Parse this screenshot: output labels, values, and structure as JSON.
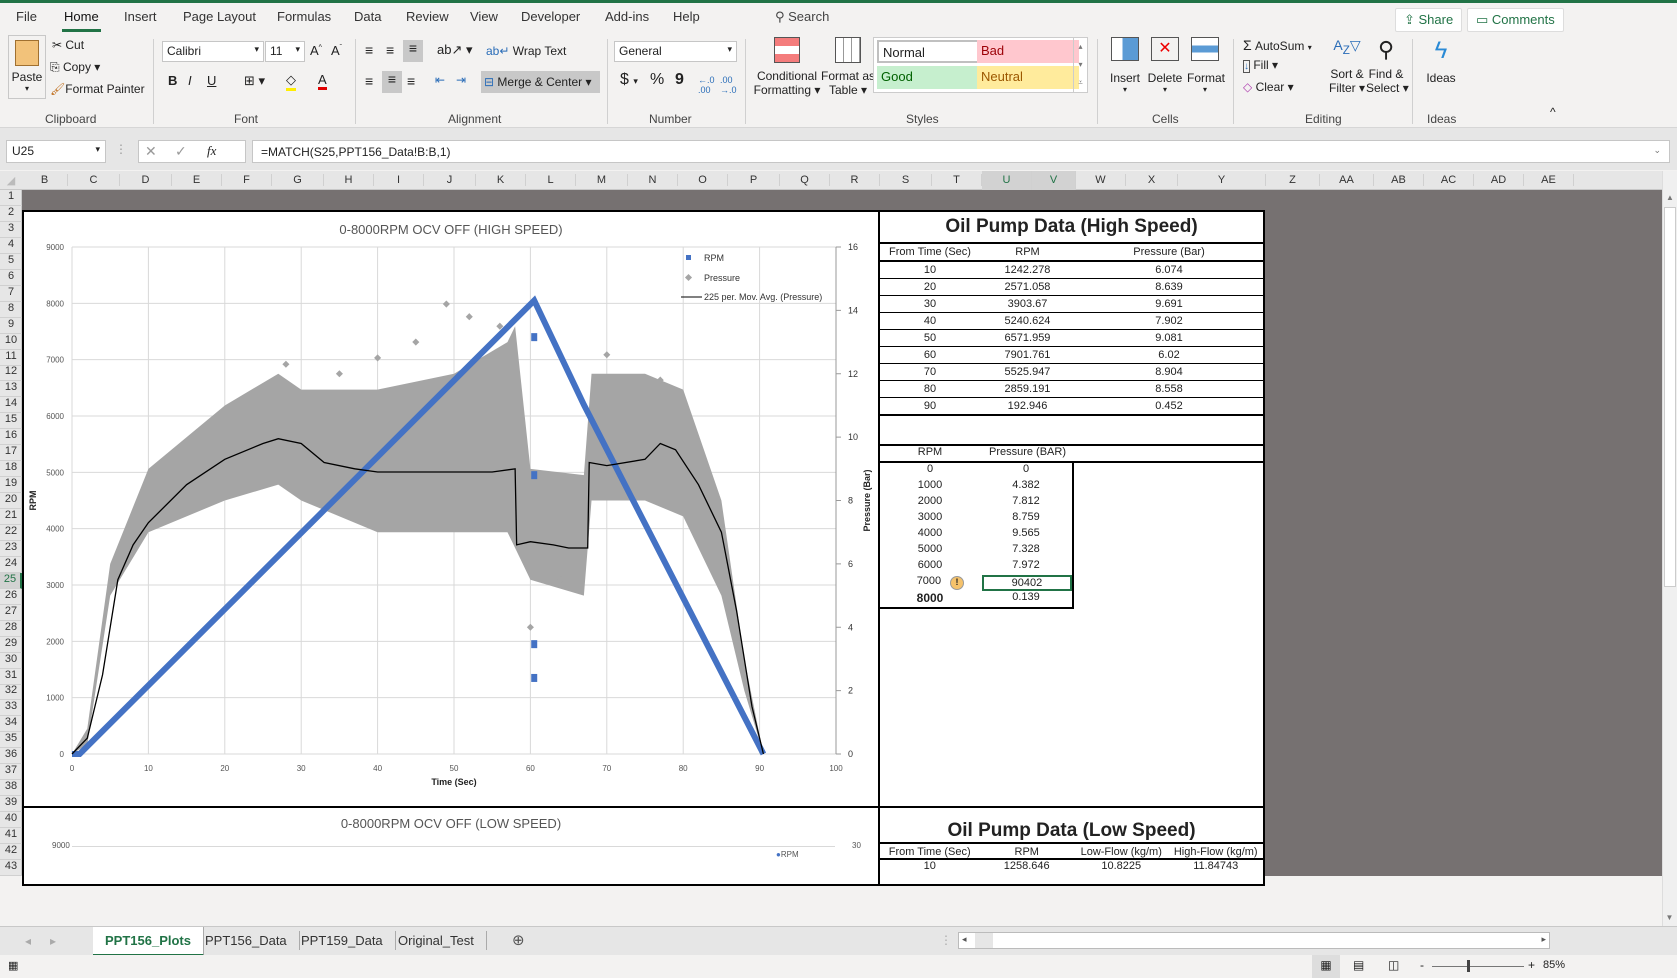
{
  "menu": {
    "items": [
      "File",
      "Home",
      "Insert",
      "Page Layout",
      "Formulas",
      "Data",
      "Review",
      "View",
      "Developer",
      "Add-ins",
      "Help"
    ],
    "active": "Home",
    "search": "Search",
    "share": "Share",
    "comments": "Comments"
  },
  "ribbon": {
    "clipboard": {
      "paste": "Paste",
      "cut": "Cut",
      "copy": "Copy",
      "format_painter": "Format Painter",
      "label": "Clipboard"
    },
    "font": {
      "name": "Calibri",
      "size": "11",
      "bold": "B",
      "italic": "I",
      "underline": "U",
      "label": "Font"
    },
    "alignment": {
      "wrap_text": "Wrap Text",
      "merge_center": "Merge & Center",
      "label": "Alignment"
    },
    "number": {
      "format": "General",
      "currency": "$",
      "percent": "%",
      "comma": "9",
      "label": "Number"
    },
    "styles": {
      "conditional": "Conditional",
      "conditional2": "Formatting",
      "format_table": "Format as",
      "format_table2": "Table",
      "normal": "Normal",
      "bad": "Bad",
      "good": "Good",
      "neutral": "Neutral",
      "label": "Styles"
    },
    "cells": {
      "insert": "Insert",
      "delete": "Delete",
      "format": "Format",
      "label": "Cells"
    },
    "editing": {
      "autosum": "AutoSum",
      "fill": "Fill",
      "clear": "Clear",
      "sort": "Sort &",
      "sort2": "Filter",
      "find": "Find &",
      "find2": "Select",
      "label": "Editing"
    },
    "ideas": {
      "ideas": "Ideas",
      "label": "Ideas"
    }
  },
  "formula_bar": {
    "name_box": "U25",
    "formula": "=MATCH(S25,PPT156_Data!B:B,1)"
  },
  "columns": [
    "B",
    "C",
    "D",
    "E",
    "F",
    "G",
    "H",
    "I",
    "J",
    "K",
    "L",
    "M",
    "N",
    "O",
    "P",
    "Q",
    "R",
    "S",
    "T",
    "U",
    "V",
    "W",
    "X",
    "Y",
    "Z",
    "AA",
    "AB",
    "AC",
    "AD",
    "AE"
  ],
  "rows": [
    "1",
    "2",
    "3",
    "4",
    "5",
    "6",
    "7",
    "8",
    "9",
    "10",
    "11",
    "12",
    "13",
    "14",
    "15",
    "16",
    "17",
    "18",
    "19",
    "20",
    "21",
    "22",
    "23",
    "24",
    "25",
    "26",
    "27",
    "28",
    "29",
    "30",
    "31",
    "32",
    "33",
    "34",
    "35",
    "36",
    "37",
    "38",
    "39",
    "40",
    "41",
    "42",
    "43"
  ],
  "chart_data": [
    {
      "type": "scatter",
      "title": "0-8000RPM OCV OFF (HIGH SPEED)",
      "xlabel": "Time (Sec)",
      "ylabel": "RPM",
      "y2label": "Pressure (Bar)",
      "xlim": [
        0,
        100
      ],
      "ylim": [
        0,
        9000
      ],
      "y2lim": [
        0,
        16
      ],
      "xticks": [
        "0",
        "10",
        "20",
        "30",
        "40",
        "50",
        "60",
        "70",
        "80",
        "90",
        "100"
      ],
      "yticks": [
        "0",
        "1000",
        "2000",
        "3000",
        "4000",
        "5000",
        "6000",
        "7000",
        "8000",
        "9000"
      ],
      "y2ticks": [
        "0",
        "2",
        "4",
        "6",
        "8",
        "10",
        "12",
        "14",
        "16"
      ],
      "grid": true,
      "legend_position": "top-right",
      "legend": [
        "RPM",
        "Pressure",
        "225 per. Mov. Avg. (Pressure)"
      ],
      "series": [
        {
          "name": "RPM",
          "color": "#4472c4",
          "x": [
            0,
            1,
            60.5,
            67,
            90.5
          ],
          "y": [
            0,
            0,
            8050,
            6200,
            0
          ]
        },
        {
          "name": "Pressure",
          "color": "#a5a5a5",
          "x": [
            0,
            2,
            5,
            10,
            20,
            27,
            30,
            40,
            50,
            57,
            58,
            60,
            67,
            68,
            75,
            80,
            85,
            88,
            90.5
          ],
          "y_low": [
            0,
            0.3,
            5,
            7,
            8,
            8.5,
            8,
            7,
            7,
            7,
            6.5,
            5.5,
            5,
            8,
            8,
            7.5,
            5,
            2,
            0
          ],
          "y_high": [
            0,
            0.8,
            6,
            9,
            11,
            12,
            11.5,
            11.5,
            12,
            13,
            13.5,
            9,
            8.8,
            12,
            12,
            11.5,
            8,
            3,
            0
          ]
        },
        {
          "name": "225 per. Mov. Avg. (Pressure)",
          "color": "#000000",
          "x": [
            0,
            2,
            4,
            6,
            8,
            10,
            15,
            20,
            25,
            27,
            30,
            33,
            37,
            40,
            45,
            50,
            55,
            58,
            58.2,
            60,
            63,
            65,
            67,
            67.5,
            67.7,
            70,
            75,
            77,
            79,
            82,
            85,
            87,
            89,
            90,
            90.5
          ],
          "y": [
            0,
            0.5,
            2.5,
            5.5,
            6.6,
            7.3,
            8.5,
            9.3,
            9.8,
            9.95,
            9.8,
            9.2,
            9,
            8.9,
            8.9,
            8.9,
            8.9,
            9,
            6.6,
            6.7,
            6.6,
            6.5,
            6.5,
            6.5,
            9.2,
            9.1,
            9.3,
            9.8,
            9.6,
            8.5,
            7,
            4.5,
            1.5,
            0.5,
            0
          ]
        }
      ]
    }
  ],
  "high_speed": {
    "title": "Oil Pump Data (High Speed)",
    "headers": [
      "From Time (Sec)",
      "RPM",
      "Pressure (Bar)"
    ],
    "rows": [
      [
        "10",
        "1242.278",
        "6.074"
      ],
      [
        "20",
        "2571.058",
        "8.639"
      ],
      [
        "30",
        "3903.67",
        "9.691"
      ],
      [
        "40",
        "5240.624",
        "7.902"
      ],
      [
        "50",
        "6571.959",
        "9.081"
      ],
      [
        "60",
        "7901.761",
        "6.02"
      ],
      [
        "70",
        "5525.947",
        "8.904"
      ],
      [
        "80",
        "2859.191",
        "8.558"
      ],
      [
        "90",
        "192.946",
        "0.452"
      ]
    ],
    "lookup_headers": [
      "RPM",
      "Pressure (BAR)"
    ],
    "lookup_rows": [
      [
        "0",
        "0"
      ],
      [
        "1000",
        "4.382"
      ],
      [
        "2000",
        "7.812"
      ],
      [
        "3000",
        "8.759"
      ],
      [
        "4000",
        "9.565"
      ],
      [
        "5000",
        "7.328"
      ],
      [
        "6000",
        "7.972"
      ],
      [
        "7000",
        "90402"
      ],
      [
        "8000",
        "0.139"
      ]
    ]
  },
  "low_speed": {
    "title": "Oil Pump Data (Low Speed)",
    "chart_title": "0-8000RPM OCV OFF (LOW SPEED)",
    "chart_y_top": "9000",
    "chart_y2_top": "30",
    "legend_rpm": "RPM",
    "headers": [
      "From Time (Sec)",
      "RPM",
      "Low-Flow (kg/m)",
      "High-Flow (kg/m)"
    ],
    "rows": [
      [
        "10",
        "1258.646",
        "10.8225",
        "11.84743"
      ]
    ]
  },
  "sheets": [
    "PPT156_Plots",
    "PPT156_Data",
    "PPT159_Data",
    "Original_Test"
  ],
  "active_sheet": "PPT156_Plots",
  "status": {
    "zoom": "85%"
  }
}
